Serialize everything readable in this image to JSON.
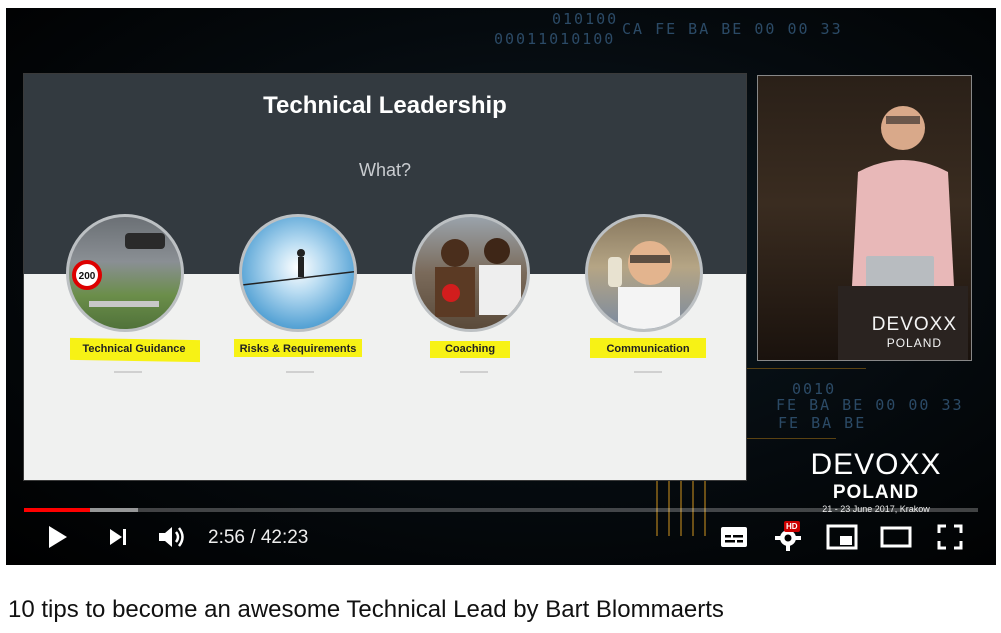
{
  "video": {
    "title": "10 tips to become an awesome Technical Lead by Bart Blommaerts",
    "current_time": "2:56",
    "duration": "42:23",
    "time_display": "2:56 / 42:23",
    "progress_fraction": 0.069,
    "buffered_fraction": 0.12,
    "progress_color": "#ff0000",
    "hd_badge": "HD"
  },
  "background": {
    "hex_lines": [
      "010100",
      "00011010100",
      "CA FE BA BE 00 00 33",
      "0010",
      "FE BA BE 00 00 33",
      "FE BA BE"
    ]
  },
  "slide": {
    "title": "Technical Leadership",
    "subtitle": "What?",
    "items": [
      {
        "label": "Technical Guidance",
        "icon": "race-track-image"
      },
      {
        "label": "Risks & Requirements",
        "icon": "tightrope-walker-image"
      },
      {
        "label": "Coaching",
        "icon": "boxing-coach-image"
      },
      {
        "label": "Communication",
        "icon": "phone-call-image"
      }
    ],
    "highlight_color": "#f7f215"
  },
  "speaker_cam": {
    "brand": "DEVOXX",
    "sub": "POLAND"
  },
  "branding": {
    "name": "DEVOXX",
    "sub": "POLAND",
    "dates": "21 - 23 June 2017, Krakow"
  },
  "controls": {
    "play": "play-icon",
    "next": "next-icon",
    "volume": "volume-icon",
    "subtitles": "subtitles-icon",
    "settings": "gear-icon",
    "miniplayer": "miniplayer-icon",
    "theater": "theater-icon",
    "fullscreen": "fullscreen-icon"
  }
}
